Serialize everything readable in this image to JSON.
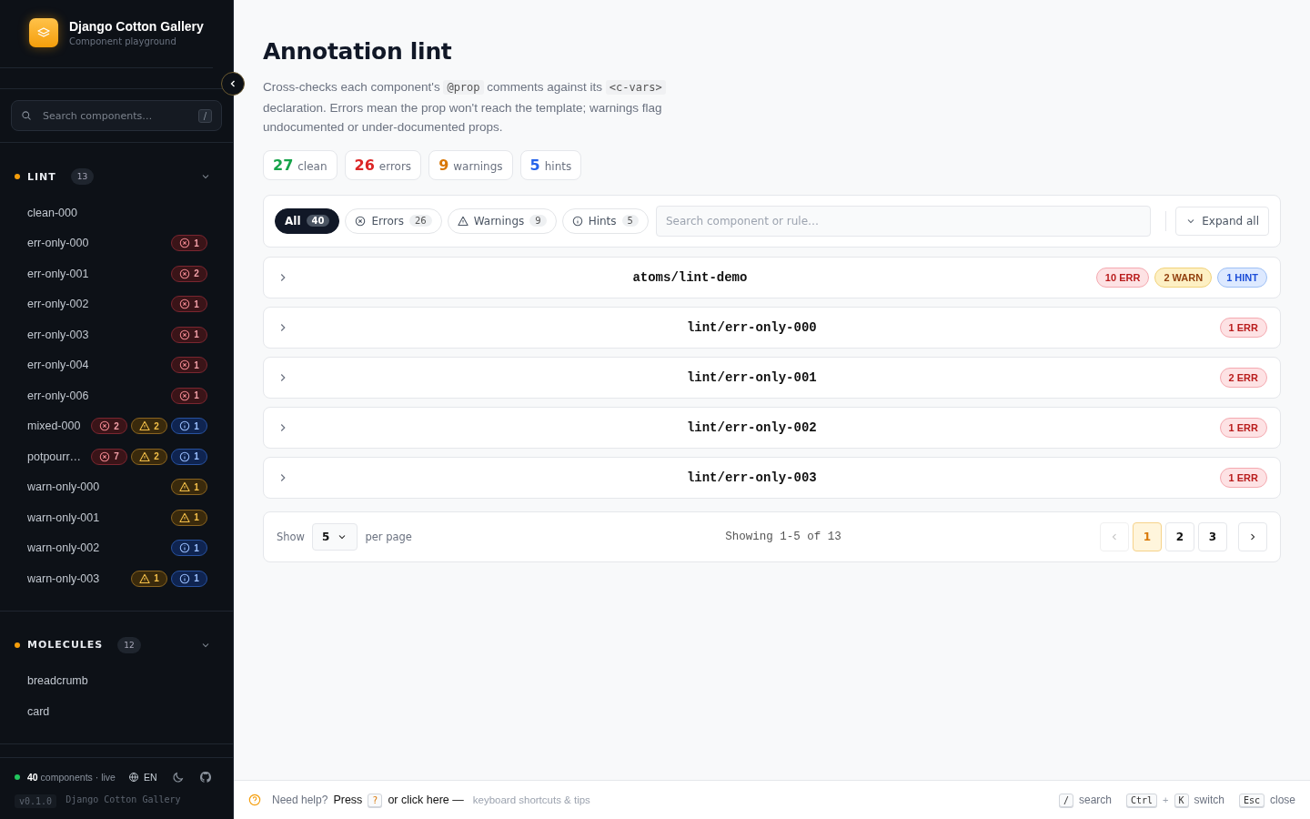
{
  "sidebar": {
    "brand": {
      "title": "Django Cotton Gallery",
      "subtitle": "Component playground"
    },
    "search": {
      "placeholder": "Search components…",
      "shortcut": "/"
    },
    "groups": [
      {
        "label": "LINT",
        "count": "13",
        "expanded": true,
        "items": [
          {
            "name": "clean-000"
          },
          {
            "name": "err-only-000",
            "badges": [
              {
                "kind": "error",
                "count": "1"
              }
            ]
          },
          {
            "name": "err-only-001",
            "badges": [
              {
                "kind": "error",
                "count": "2"
              }
            ]
          },
          {
            "name": "err-only-002",
            "badges": [
              {
                "kind": "error",
                "count": "1"
              }
            ]
          },
          {
            "name": "err-only-003",
            "badges": [
              {
                "kind": "error",
                "count": "1"
              }
            ]
          },
          {
            "name": "err-only-004",
            "badges": [
              {
                "kind": "error",
                "count": "1"
              }
            ]
          },
          {
            "name": "err-only-006",
            "badges": [
              {
                "kind": "error",
                "count": "1"
              }
            ]
          },
          {
            "name": "mixed-000",
            "badges": [
              {
                "kind": "error",
                "count": "2"
              },
              {
                "kind": "warning",
                "count": "2"
              },
              {
                "kind": "hint",
                "count": "1"
              }
            ]
          },
          {
            "name": "potpourr…",
            "badges": [
              {
                "kind": "error",
                "count": "7"
              },
              {
                "kind": "warning",
                "count": "2"
              },
              {
                "kind": "hint",
                "count": "1"
              }
            ]
          },
          {
            "name": "warn-only-000",
            "badges": [
              {
                "kind": "warning",
                "count": "1"
              }
            ]
          },
          {
            "name": "warn-only-001",
            "badges": [
              {
                "kind": "warning",
                "count": "1"
              }
            ]
          },
          {
            "name": "warn-only-002",
            "badges": [
              {
                "kind": "hint",
                "count": "1"
              }
            ]
          },
          {
            "name": "warn-only-003",
            "badges": [
              {
                "kind": "warning",
                "count": "1"
              },
              {
                "kind": "hint",
                "count": "1"
              }
            ]
          }
        ]
      },
      {
        "label": "MOLECULES",
        "count": "12",
        "expanded": true,
        "items": [
          {
            "name": "breadcrumb"
          },
          {
            "name": "card"
          }
        ]
      }
    ],
    "footer": {
      "count": "40",
      "label": "components · live",
      "language": "EN",
      "version": "v0.1.0",
      "name": "Django Cotton Gallery"
    }
  },
  "main": {
    "title": "Annotation lint",
    "description": [
      {
        "kind": "text",
        "text": "Cross-checks each component's "
      },
      {
        "kind": "code",
        "text": "@prop"
      },
      {
        "kind": "text",
        "text": " comments against its "
      },
      {
        "kind": "code",
        "text": "<c-vars>"
      },
      {
        "kind": "text",
        "text": " declaration. Errors mean the prop won't reach the template; warnings flag undocumented or under-documented props."
      }
    ],
    "stats": [
      {
        "kind": "clean",
        "count": "27",
        "label": "clean"
      },
      {
        "kind": "error",
        "count": "26",
        "label": "errors"
      },
      {
        "kind": "warning",
        "count": "9",
        "label": "warnings"
      },
      {
        "kind": "hint",
        "count": "5",
        "label": "hints"
      }
    ],
    "filters": [
      {
        "kind": "all",
        "label": "All",
        "count": "40",
        "selected": true
      },
      {
        "kind": "error",
        "label": "Errors",
        "count": "26",
        "selected": false
      },
      {
        "kind": "warning",
        "label": "Warnings",
        "count": "9",
        "selected": false
      },
      {
        "kind": "hint",
        "label": "Hints",
        "count": "5",
        "selected": false
      }
    ],
    "search": {
      "placeholder": "Search component or rule…"
    },
    "expand_button": "Expand all",
    "rows": [
      {
        "path": "atoms/lint-demo",
        "expanded": false,
        "badges": [
          {
            "kind": "error",
            "label": "10 ERR"
          },
          {
            "kind": "warning",
            "label": "2 WARN"
          },
          {
            "kind": "hint",
            "label": "1 HINT"
          }
        ]
      },
      {
        "path": "lint/err-only-000",
        "expanded": false,
        "badges": [
          {
            "kind": "error",
            "label": "1 ERR"
          }
        ]
      },
      {
        "path": "lint/err-only-001",
        "expanded": false,
        "badges": [
          {
            "kind": "error",
            "label": "2 ERR"
          }
        ]
      },
      {
        "path": "lint/err-only-002",
        "expanded": false,
        "badges": [
          {
            "kind": "error",
            "label": "1 ERR"
          }
        ]
      },
      {
        "path": "lint/err-only-003",
        "expanded": false,
        "badges": [
          {
            "kind": "error",
            "label": "1 ERR"
          }
        ]
      }
    ],
    "pagination": {
      "show_label": "Show",
      "per_page": "5",
      "per_page_label": "per page",
      "summary": "Showing 1-5 of 13",
      "prev_disabled": true,
      "pages": [
        {
          "label": "1",
          "selected": true
        },
        {
          "label": "2",
          "selected": false
        },
        {
          "label": "3",
          "selected": false
        }
      ]
    }
  },
  "help_bar": {
    "lead": "Need help?",
    "press": "Press",
    "key": "?",
    "click": "or click here —",
    "tail": "keyboard shortcuts & tips",
    "shortcuts": [
      {
        "keys": [
          "/"
        ],
        "label": "search"
      },
      {
        "keys": [
          "Ctrl",
          "K"
        ],
        "joiner": "+",
        "label": "switch"
      },
      {
        "keys": [
          "Esc"
        ],
        "label": "close"
      }
    ]
  }
}
